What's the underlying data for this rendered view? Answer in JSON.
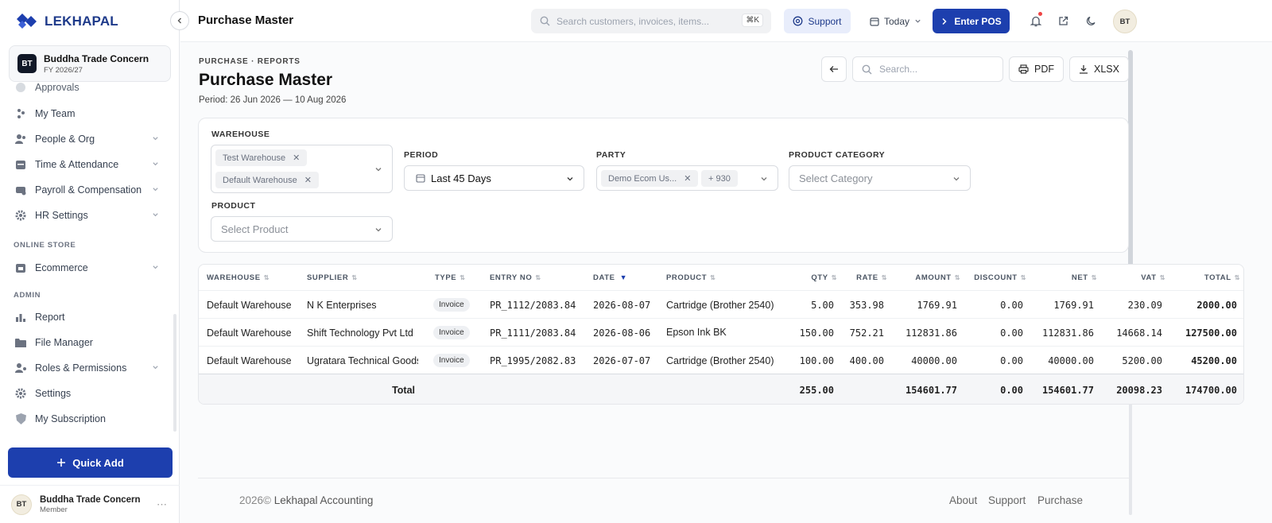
{
  "brand": {
    "name": "LEKHAPAL",
    "logo_icon": "diamond-logo-icon",
    "color": "#1d3fae"
  },
  "org": {
    "initials": "BT",
    "name": "Buddha Trade Concern",
    "fy": "FY 2026/27"
  },
  "sidebar": {
    "partial_item": "Approvals",
    "items": [
      {
        "label": "My Team",
        "icon": "team-icon",
        "has_chevron": false
      },
      {
        "label": "People & Org",
        "icon": "people-icon",
        "has_chevron": true
      },
      {
        "label": "Time & Attendance",
        "icon": "calendar-icon",
        "has_chevron": true
      },
      {
        "label": "Payroll & Compensation",
        "icon": "payroll-icon",
        "has_chevron": true
      },
      {
        "label": "HR Settings",
        "icon": "gear-icon",
        "has_chevron": true
      }
    ],
    "section_online_store": "ONLINE STORE",
    "store_items": [
      {
        "label": "Ecommerce",
        "icon": "store-icon",
        "has_chevron": true
      }
    ],
    "section_admin": "ADMIN",
    "admin_items": [
      {
        "label": "Report",
        "icon": "bar-chart-icon",
        "has_chevron": false
      },
      {
        "label": "File Manager",
        "icon": "folder-icon",
        "has_chevron": false
      },
      {
        "label": "Roles & Permissions",
        "icon": "users-key-icon",
        "has_chevron": true
      },
      {
        "label": "Settings",
        "icon": "cog-icon",
        "has_chevron": false
      },
      {
        "label": "My Subscription",
        "icon": "shield-icon",
        "has_chevron": false
      }
    ],
    "quick_add": "Quick Add",
    "user": {
      "initials": "BT",
      "name": "Buddha Trade Concern",
      "role": "Member"
    }
  },
  "topbar": {
    "title": "Purchase Master",
    "search_placeholder": "Search customers, invoices, items...",
    "search_shortcut": "⌘K",
    "support": "Support",
    "date_range": "Today",
    "enter_pos": "Enter POS",
    "avatar": "BT"
  },
  "report": {
    "breadcrumb": "PURCHASE · REPORTS",
    "title": "Purchase Master",
    "period_text": "Period: 26 Jun 2026 — 10 Aug 2026",
    "search_placeholder": "Search...",
    "pdf": "PDF",
    "xlsx": "XLSX"
  },
  "filters": {
    "warehouse": {
      "label": "WAREHOUSE",
      "chips": [
        "Test Warehouse",
        "Default Warehouse"
      ]
    },
    "period": {
      "label": "PERIOD",
      "value": "Last 45 Days"
    },
    "party": {
      "label": "PARTY",
      "chip": "Demo Ecom Us...",
      "more": "+ 930"
    },
    "product_category": {
      "label": "PRODUCT CATEGORY",
      "placeholder": "Select Category"
    },
    "product": {
      "label": "PRODUCT",
      "placeholder": "Select Product"
    }
  },
  "table": {
    "columns": [
      "WAREHOUSE",
      "SUPPLIER",
      "TYPE",
      "ENTRY NO",
      "DATE",
      "PRODUCT",
      "QTY",
      "RATE",
      "AMOUNT",
      "DISCOUNT",
      "NET",
      "VAT",
      "TOTAL"
    ],
    "sorted_column": "DATE",
    "rows": [
      {
        "warehouse": "Default Warehouse",
        "supplier": "N K Enterprises",
        "type": "Invoice",
        "entry_no": "PR_1112/2083.84",
        "date": "2026-08-07",
        "product": "Cartridge (Brother 2540)",
        "qty": "5.00",
        "rate": "353.98",
        "amount": "1769.91",
        "discount": "0.00",
        "net": "1769.91",
        "vat": "230.09",
        "total": "2000.00"
      },
      {
        "warehouse": "Default Warehouse",
        "supplier": "Shift Technology Pvt Ltd",
        "type": "Invoice",
        "entry_no": "PR_1111/2083.84",
        "date": "2026-08-06",
        "product": "Epson Ink BK",
        "qty": "150.00",
        "rate": "752.21",
        "amount": "112831.86",
        "discount": "0.00",
        "net": "112831.86",
        "vat": "14668.14",
        "total": "127500.00"
      },
      {
        "warehouse": "Default Warehouse",
        "supplier": "Ugratara Technical Goods",
        "type": "Invoice",
        "entry_no": "PR_1995/2082.83",
        "date": "2026-07-07",
        "product": "Cartridge (Brother 2540)",
        "qty": "100.00",
        "rate": "400.00",
        "amount": "40000.00",
        "discount": "0.00",
        "net": "40000.00",
        "vat": "5200.00",
        "total": "45200.00"
      }
    ],
    "totals": {
      "label": "Total",
      "qty": "255.00",
      "amount": "154601.77",
      "discount": "0.00",
      "net": "154601.77",
      "vat": "20098.23",
      "total": "174700.00"
    }
  },
  "footer": {
    "year": "2026©",
    "company": "Lekhapal Accounting",
    "links": [
      "About",
      "Support",
      "Purchase"
    ]
  }
}
